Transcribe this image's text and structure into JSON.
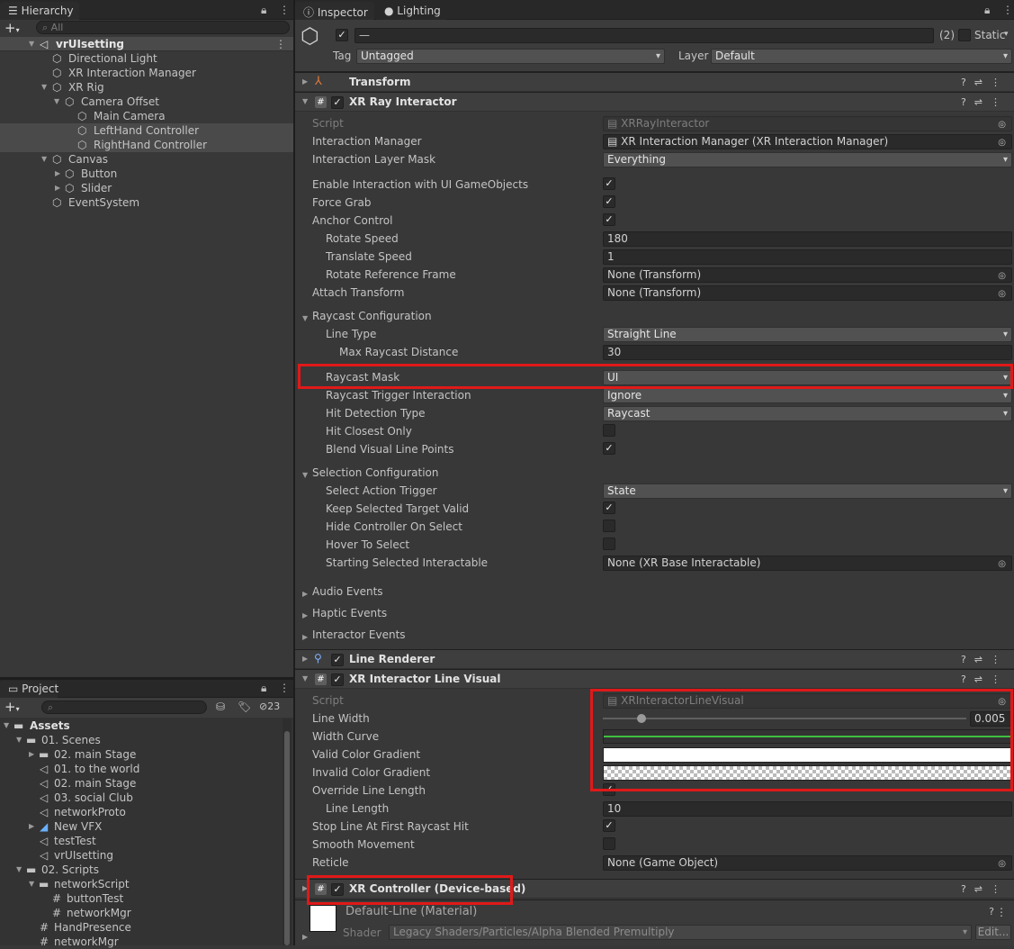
{
  "hierarchy": {
    "tab": "Hierarchy",
    "search_placeholder": "All",
    "scene": "vrUIsetting",
    "items": [
      "Directional Light",
      "XR Interaction Manager",
      "XR Rig",
      "Camera Offset",
      "Main Camera",
      "LeftHand Controller",
      "RightHand Controller",
      "Canvas",
      "Button",
      "Slider",
      "EventSystem"
    ]
  },
  "project": {
    "tab": "Project",
    "hidden_count": "23",
    "items": [
      "Assets",
      "01. Scenes",
      "02. main Stage",
      "01. to the world",
      "02. main Stage",
      "03. social Club",
      "networkProto",
      "New VFX",
      "testTest",
      "vrUIsetting",
      "02. Scripts",
      "networkScript",
      "buttonTest",
      "networkMgr",
      "HandPresence",
      "networkMgr"
    ]
  },
  "inspector": {
    "tabs": [
      "Inspector",
      "Lighting"
    ],
    "object_name": "—",
    "count": "(2)",
    "static_label": "Static",
    "tag_label": "Tag",
    "tag_value": "Untagged",
    "layer_label": "Layer",
    "layer_value": "Default",
    "components": {
      "transform": "Transform",
      "ray": "XR Ray Interactor",
      "line_renderer": "Line Renderer",
      "line_visual": "XR Interactor Line Visual",
      "controller": "XR Controller (Device-based)"
    },
    "ray": {
      "script_label": "Script",
      "script_value": "XRRayInteractor",
      "im_label": "Interaction Manager",
      "im_value": "XR Interaction Manager (XR Interaction Manager)",
      "ilm_label": "Interaction Layer Mask",
      "ilm_value": "Everything",
      "enable_ui": "Enable Interaction with UI GameObjects",
      "force_grab": "Force Grab",
      "anchor": "Anchor Control",
      "rotate_label": "Rotate Speed",
      "rotate_value": "180",
      "translate_label": "Translate Speed",
      "translate_value": "1",
      "rrf_label": "Rotate Reference Frame",
      "rrf_value": "None (Transform)",
      "attach_label": "Attach Transform",
      "attach_value": "None (Transform)",
      "raycast_cfg": "Raycast Configuration",
      "line_type_label": "Line Type",
      "line_type_value": "Straight Line",
      "max_dist_label": "Max Raycast Distance",
      "max_dist_value": "30",
      "mask_label": "Raycast Mask",
      "mask_value": "UI",
      "trigger_label": "Raycast Trigger Interaction",
      "trigger_value": "Ignore",
      "hit_label": "Hit Detection Type",
      "hit_value": "Raycast",
      "hit_closest": "Hit Closest Only",
      "blend": "Blend Visual Line Points",
      "selection_cfg": "Selection Configuration",
      "sat_label": "Select Action Trigger",
      "sat_value": "State",
      "keep": "Keep Selected Target Valid",
      "hide": "Hide Controller On Select",
      "hover": "Hover To Select",
      "ssi_label": "Starting Selected Interactable",
      "ssi_value": "None (XR Base Interactable)",
      "audio": "Audio Events",
      "haptic": "Haptic Events",
      "interactor": "Interactor Events"
    },
    "visual": {
      "script_label": "Script",
      "script_value": "XRInteractorLineVisual",
      "lw_label": "Line Width",
      "lw_value": "0.005",
      "wc_label": "Width Curve",
      "vcg_label": "Valid Color Gradient",
      "icg_label": "Invalid Color Gradient",
      "oll_label": "Override Line Length",
      "ll_label": "Line Length",
      "ll_value": "10",
      "stop_label": "Stop Line At First Raycast Hit",
      "smooth_label": "Smooth Movement",
      "reticle_label": "Reticle",
      "reticle_value": "None (Game Object)"
    },
    "material": {
      "name": "Default-Line (Material)",
      "shader_label": "Shader",
      "shader_value": "Legacy Shaders/Particles/Alpha Blended Premultiply",
      "edit": "Edit..."
    }
  },
  "colors": {
    "highlight": "#e01919",
    "selection": "#4a4a4a",
    "curve": "#3fbf3f"
  }
}
